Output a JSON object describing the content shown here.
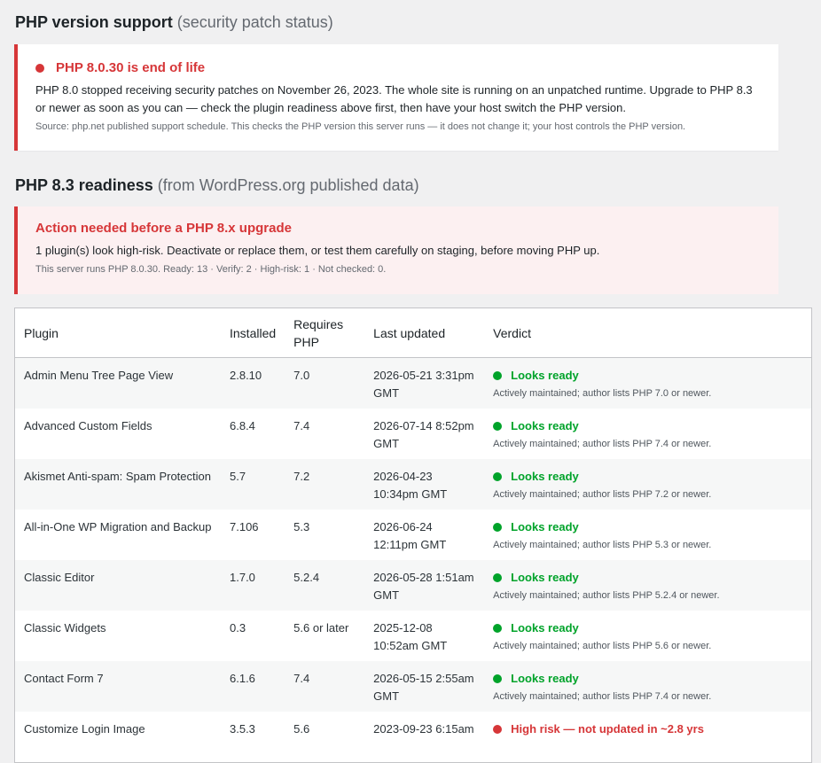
{
  "php_support": {
    "heading": "PHP version support",
    "heading_sub": "(security patch status)",
    "notice_title": "PHP 8.0.30 is end of life",
    "notice_body": "PHP 8.0 stopped receiving security patches on November 26, 2023. The whole site is running on an unpatched runtime. Upgrade to PHP 8.3 or newer as soon as you can — check the plugin readiness above first, then have your host switch the PHP version.",
    "notice_source": "Source: php.net published support schedule. This checks the PHP version this server runs — it does not change it; your host controls the PHP version."
  },
  "readiness": {
    "heading": "PHP 8.3 readiness",
    "heading_sub": "(from WordPress.org published data)",
    "notice_title": "Action needed before a PHP 8.x upgrade",
    "notice_body": "1 plugin(s) look high-risk. Deactivate or replace them, or test them carefully on staging, before moving PHP up.",
    "notice_summary": "This server runs PHP 8.0.30. Ready: 13 · Verify: 2 · High-risk: 1 · Not checked: 0."
  },
  "table": {
    "headers": {
      "plugin": "Plugin",
      "installed": "Installed",
      "requires": "Requires PHP",
      "updated": "Last updated",
      "verdict": "Verdict"
    },
    "rows": [
      {
        "plugin": "Admin Menu Tree Page View",
        "installed": "2.8.10",
        "requires": "7.0",
        "updated": "2026-05-21 3:31pm GMT",
        "verdict": "Looks ready",
        "note": "Actively maintained; author lists PHP 7.0 or newer."
      },
      {
        "plugin": "Advanced Custom Fields",
        "installed": "6.8.4",
        "requires": "7.4",
        "updated": "2026-07-14 8:52pm GMT",
        "verdict": "Looks ready",
        "note": "Actively maintained; author lists PHP 7.4 or newer."
      },
      {
        "plugin": "Akismet Anti-spam: Spam Protection",
        "installed": "5.7",
        "requires": "7.2",
        "updated": "2026-04-23 10:34pm GMT",
        "verdict": "Looks ready",
        "note": "Actively maintained; author lists PHP 7.2 or newer."
      },
      {
        "plugin": "All-in-One WP Migration and Backup",
        "installed": "7.106",
        "requires": "5.3",
        "updated": "2026-06-24 12:11pm GMT",
        "verdict": "Looks ready",
        "note": "Actively maintained; author lists PHP 5.3 or newer."
      },
      {
        "plugin": "Classic Editor",
        "installed": "1.7.0",
        "requires": "5.2.4",
        "updated": "2026-05-28 1:51am GMT",
        "verdict": "Looks ready",
        "note": "Actively maintained; author lists PHP 5.2.4 or newer."
      },
      {
        "plugin": "Classic Widgets",
        "installed": "0.3",
        "requires": "5.6 or later",
        "updated": "2025-12-08 10:52am GMT",
        "verdict": "Looks ready",
        "note": "Actively maintained; author lists PHP 5.6 or newer."
      },
      {
        "plugin": "Contact Form 7",
        "installed": "6.1.6",
        "requires": "7.4",
        "updated": "2026-05-15 2:55am GMT",
        "verdict": "Looks ready",
        "note": "Actively maintained; author lists PHP 7.4 or newer."
      },
      {
        "plugin": "Customize Login Image",
        "installed": "3.5.3",
        "requires": "5.6",
        "updated": "2023-09-23 6:15am",
        "verdict": "High risk — not updated in ~2.8 yrs",
        "note": ""
      }
    ]
  },
  "colors": {
    "ok": "#00a32a",
    "danger": "#d63638"
  }
}
